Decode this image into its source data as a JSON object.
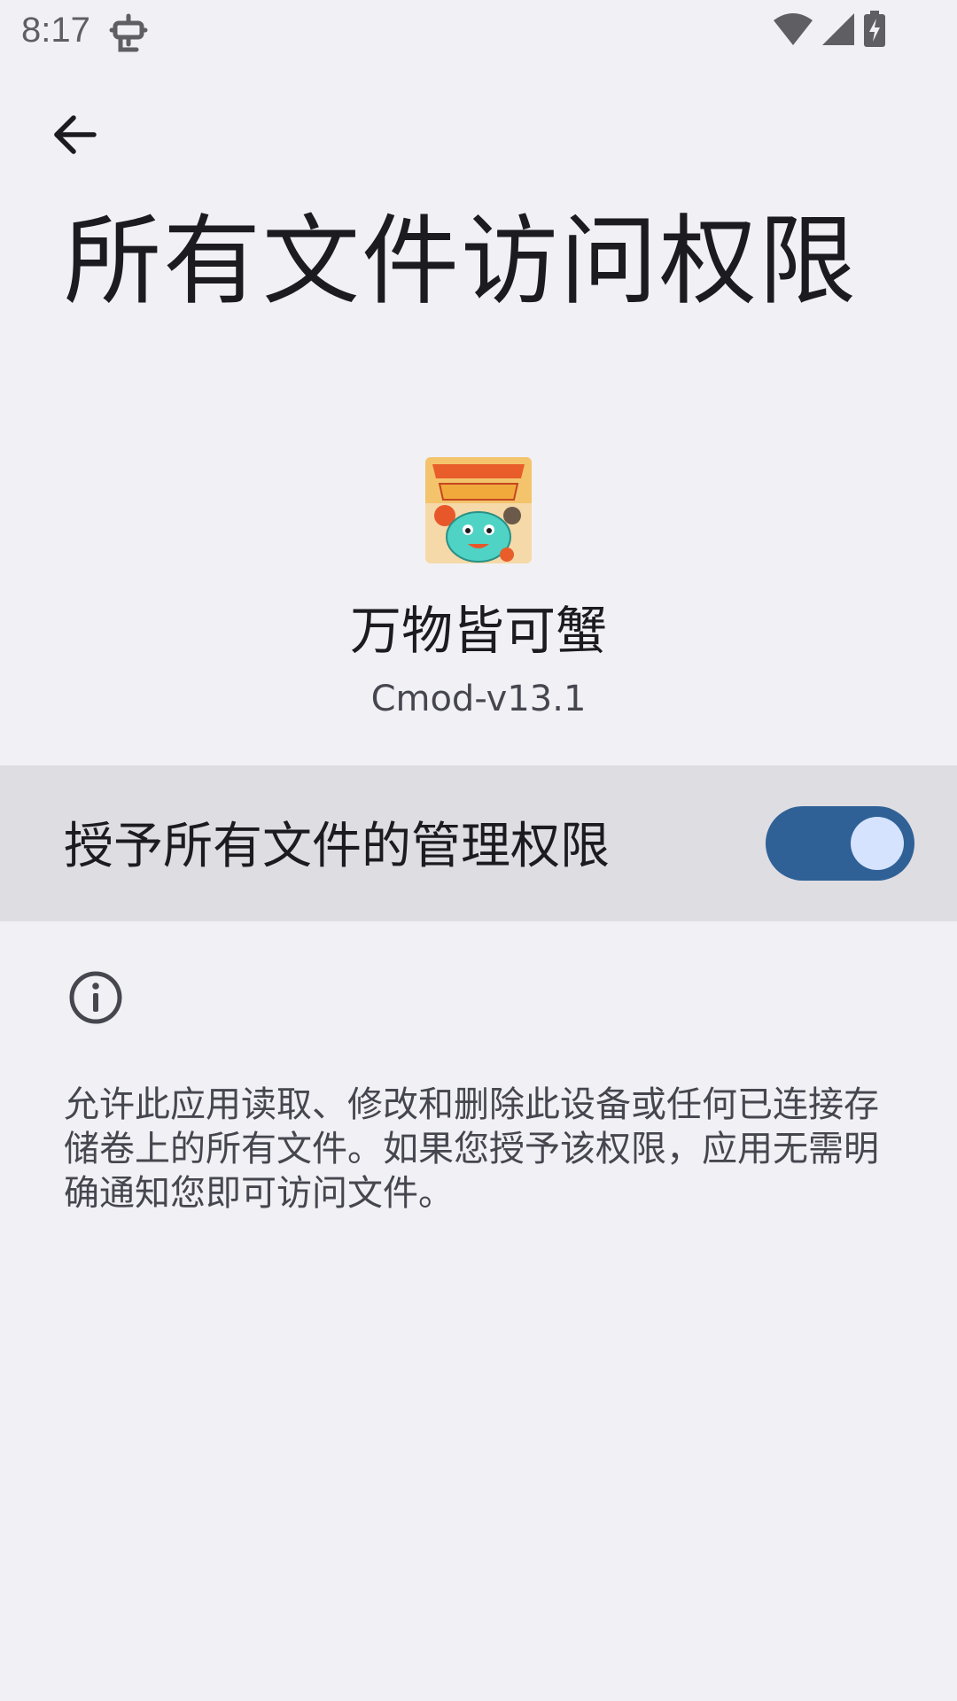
{
  "status_bar": {
    "time": "8:17",
    "icons": [
      "debug-bug-icon",
      "wifi-icon",
      "signal-icon",
      "battery-charging-icon"
    ]
  },
  "header": {
    "back_icon": "arrow-left-icon",
    "title": "所有文件访问权限"
  },
  "app": {
    "icon": "everything-is-crab-app-icon",
    "name": "万物皆可蟹",
    "version": "Cmod-v13.1"
  },
  "permission": {
    "label": "授予所有文件的管理权限",
    "enabled": true,
    "accent_color": "#2f6196"
  },
  "info": {
    "icon": "info-icon",
    "description": "允许此应用读取、修改和删除此设备或任何已连接存储卷上的所有文件。如果您授予该权限，应用无需明确通知您即可访问文件。"
  }
}
